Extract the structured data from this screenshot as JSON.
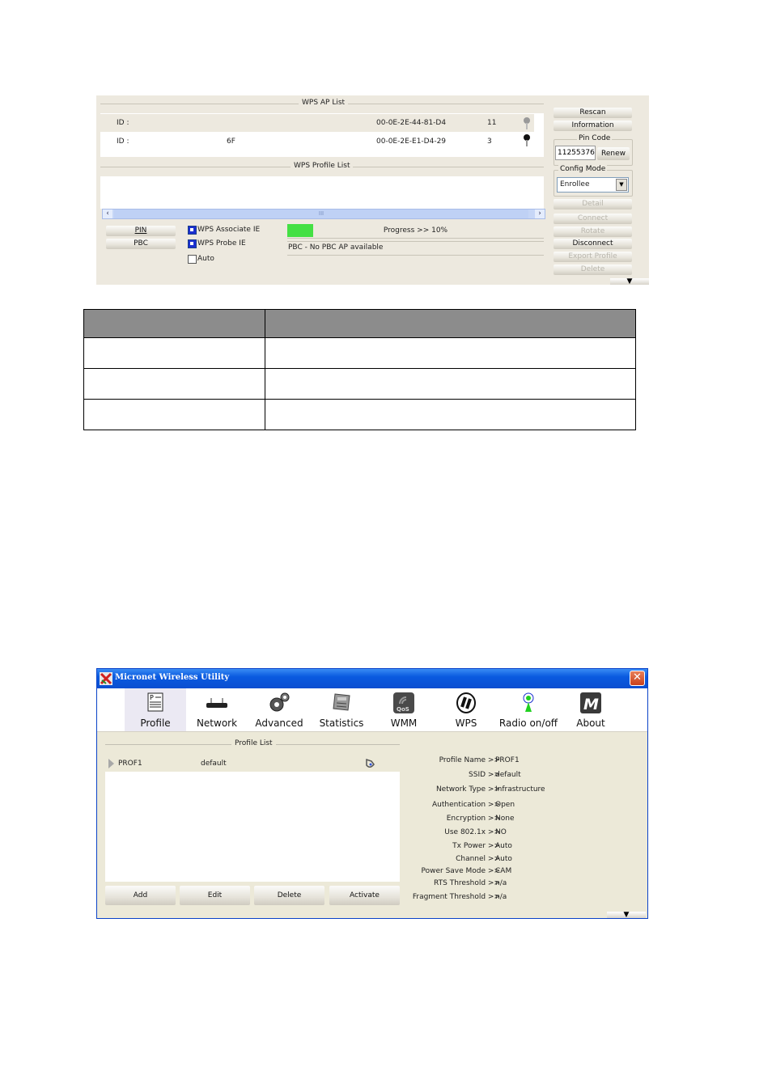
{
  "wps_panel": {
    "ap_list_title": "WPS AP List",
    "ap_list": [
      {
        "id_label": "ID :",
        "ssid": "",
        "bssid": "00-0E-2E-44-81-D4",
        "channel": "11",
        "icon": "key-icon-gray"
      },
      {
        "id_label": "ID :",
        "ssid": "6F",
        "bssid": "00-0E-2E-E1-D4-29",
        "channel": "3",
        "icon": "key-icon-black"
      }
    ],
    "profile_list_title": "WPS Profile List",
    "scroll_thumb_label": "III",
    "pin_button": "PIN",
    "pbc_button": "PBC",
    "checkboxes": [
      {
        "label": "WPS Associate IE",
        "checked": true
      },
      {
        "label": "WPS Probe IE",
        "checked": true
      },
      {
        "label": "Auto",
        "checked": false
      }
    ],
    "progress_label": "Progress >> 10%",
    "progress_value": 0.1,
    "progress_color": "#44e044",
    "status_text": "PBC - No PBC AP available",
    "side": {
      "rescan": "Rescan",
      "information": "Information",
      "pin_code_title": "Pin Code",
      "pin_code_value": "11255376",
      "renew": "Renew",
      "config_mode_title": "Config Mode",
      "config_mode_value": "Enrollee",
      "detail": "Detail",
      "connect": "Connect",
      "rotate": "Rotate",
      "disconnect": "Disconnect",
      "export_profile": "Export Profile",
      "delete": "Delete"
    }
  },
  "description_table": {
    "header": [
      "",
      ""
    ],
    "rows": [
      [
        "",
        ""
      ],
      [
        "",
        ""
      ],
      [
        "",
        ""
      ]
    ]
  },
  "main_window": {
    "title": "Micronet Wireless Utility",
    "toolbar": [
      {
        "label": "Profile",
        "icon": "profile-icon",
        "active": true
      },
      {
        "label": "Network",
        "icon": "network-icon",
        "active": false
      },
      {
        "label": "Advanced",
        "icon": "gears-icon",
        "active": false
      },
      {
        "label": "Statistics",
        "icon": "statistics-icon",
        "active": false
      },
      {
        "label": "WMM",
        "icon": "qos-icon",
        "active": false
      },
      {
        "label": "WPS",
        "icon": "wps-icon",
        "active": false
      },
      {
        "label": "Radio on/off",
        "icon": "radio-icon",
        "active": false
      },
      {
        "label": "About",
        "icon": "about-icon",
        "active": false
      }
    ],
    "profile_list_title": "Profile List",
    "profiles": [
      {
        "name": "PROF1",
        "ssid": "default",
        "icon": "infrastructure-icon"
      }
    ],
    "buttons": {
      "add": "Add",
      "edit": "Edit",
      "delete": "Delete",
      "activate": "Activate"
    },
    "details": [
      {
        "label": "Profile Name >>",
        "value": "PROF1"
      },
      {
        "label": "SSID >>",
        "value": "default"
      },
      {
        "label": "Network Type >>",
        "value": "Infrastructure"
      },
      {
        "label": "Authentication >>",
        "value": "Open"
      },
      {
        "label": "Encryption >>",
        "value": "None"
      },
      {
        "label": "Use 802.1x >>",
        "value": "NO"
      },
      {
        "label": "Tx Power >>",
        "value": "Auto"
      },
      {
        "label": "Channel >>",
        "value": "Auto"
      },
      {
        "label": "Power Save Mode >>",
        "value": "CAM"
      },
      {
        "label": "RTS Threshold >>",
        "value": "n/a"
      },
      {
        "label": "Fragment Threshold >>",
        "value": "n/a"
      }
    ]
  }
}
